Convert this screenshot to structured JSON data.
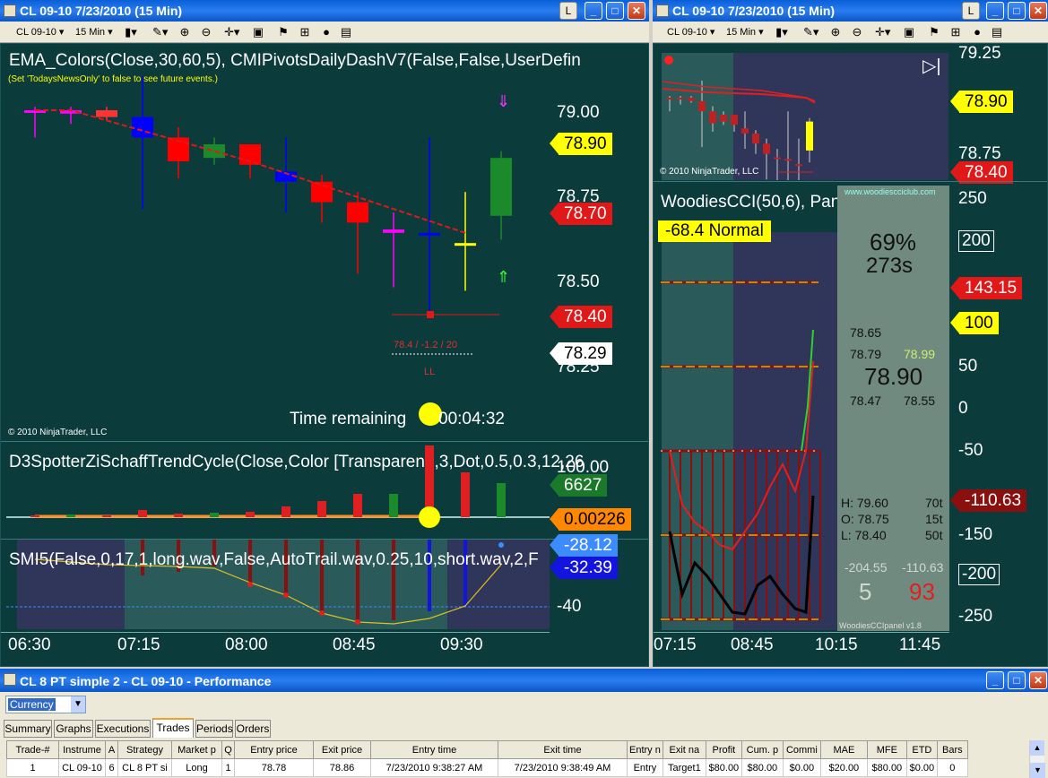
{
  "left_window": {
    "title": "CL 09-10  7/23/2010 (15 Min)",
    "l_button": "L",
    "instrument": "CL 09-10",
    "interval": "15 Min",
    "price_panel": {
      "indicator_label": "EMA_Colors(Close,30,60,5),   CMIPivotsDailyDashV7(False,False,UserDefin",
      "news_note": "(Set 'TodaysNewsOnly' to false to see future events.)",
      "copyright": "© 2010 NinjaTrader, LLC",
      "time_remaining_label": "Time remaining",
      "time_remaining_value": "00:04:32",
      "ll_label": "LL",
      "level_note": "78.4 / -1.2 / 20",
      "axis_labels": [
        "79.00",
        "78.75",
        "78.50",
        "78.25"
      ],
      "tags": [
        "78.90",
        "78.70",
        "78.40",
        "78.29"
      ],
      "candles": [
        {
          "o": 79.0,
          "h": 79.01,
          "l": 78.92,
          "c": 79.0,
          "color": "#ff00ff"
        },
        {
          "o": 78.99,
          "h": 79.01,
          "l": 78.96,
          "c": 79.0,
          "color": "#ff00ff"
        },
        {
          "o": 79.0,
          "h": 79.01,
          "l": 78.97,
          "c": 78.98,
          "color": "#ff3333"
        },
        {
          "o": 78.98,
          "h": 79.1,
          "l": 78.71,
          "c": 78.92,
          "color": "#0000ff"
        },
        {
          "o": 78.92,
          "h": 78.95,
          "l": 78.8,
          "c": 78.85,
          "color": "#ff0000"
        },
        {
          "o": 78.86,
          "h": 78.92,
          "l": 78.84,
          "c": 78.9,
          "color": "#1a8a2a"
        },
        {
          "o": 78.9,
          "h": 78.9,
          "l": 78.8,
          "c": 78.84,
          "color": "#ff0000"
        },
        {
          "o": 78.82,
          "h": 78.92,
          "l": 78.7,
          "c": 78.79,
          "color": "#0000ff"
        },
        {
          "o": 78.79,
          "h": 78.81,
          "l": 78.67,
          "c": 78.73,
          "color": "#ff0000"
        },
        {
          "o": 78.73,
          "h": 78.76,
          "l": 78.52,
          "c": 78.67,
          "color": "#ff0000"
        },
        {
          "o": 78.65,
          "h": 78.7,
          "l": 78.48,
          "c": 78.64,
          "color": "#ff00ff"
        },
        {
          "o": 78.64,
          "h": 78.92,
          "l": 78.4,
          "c": 78.64,
          "color": "#0000ff"
        },
        {
          "o": 78.61,
          "h": 78.76,
          "l": 78.47,
          "c": 78.61,
          "color": "#ffff00"
        },
        {
          "o": 78.69,
          "h": 78.88,
          "l": 78.62,
          "c": 78.86,
          "color": "#1a8a2a"
        }
      ]
    },
    "schaff_panel": {
      "label": "D3SpotterZiSchaffTrendCycle(Close,Color [Transparent],3,Dot,0.5,0.3,12,26",
      "axis_label": "100.00",
      "tags": [
        "6627",
        "0.00226"
      ]
    },
    "smi_panel": {
      "label": "SMI5(False,0,17,1,long.wav,False,AutoTrail.wav,0.25,10,short.wav,2,F",
      "axis_label": "-40",
      "tags": [
        "-28.12",
        "-32.39"
      ]
    },
    "time_labels": [
      "06:30",
      "07:15",
      "08:00",
      "08:45",
      "09:30"
    ]
  },
  "right_window": {
    "title": "CL 09-10  7/23/2010 (15 Min)",
    "l_button": "L",
    "instrument": "CL 09-10",
    "interval": "15 Min",
    "copyright": "© 2010 NinjaTrader, LLC",
    "price_axis": [
      "79.25",
      "78.75"
    ],
    "price_tags": [
      "78.90",
      "78.40"
    ],
    "cci_label": "WoodiesCCI(50,6), Panel(50)",
    "cci_status": "-68.4 Normal",
    "cci_brand": "www.woodiescciclub.com",
    "cci_axis": [
      "250",
      "200",
      "150",
      "100",
      "50",
      "0",
      "-50",
      "-100",
      "-150",
      "-200",
      "-250"
    ],
    "cci_tags": [
      "143.15",
      "100",
      "-110.63"
    ],
    "dash": {
      "pct": "69%",
      "secs": "273s",
      "p1": "78.65",
      "p2": "78.79",
      "p2b": "78.99",
      "big": "78.90",
      "p3": "78.47",
      "p3b": "78.55",
      "h_label": "H: 79.60",
      "h_ticks": "70t",
      "o_label": "O: 78.75",
      "o_ticks": "15t",
      "l_label": "L: 78.40",
      "l_ticks": "50t",
      "v1": "-204.55",
      "v2": "-110.63",
      "n1": "5",
      "n2": "93",
      "version": "WoodiesCCIpanel v1.8"
    },
    "time_labels": [
      "07:15",
      "08:45",
      "10:15",
      "11:45"
    ]
  },
  "perf_window": {
    "title": "CL 8 PT simple 2 - CL 09-10 - Performance",
    "display_select": "Currency",
    "tabs": [
      "Summary",
      "Graphs",
      "Executions",
      "Trades",
      "Periods",
      "Orders"
    ],
    "active_tab": "Trades",
    "columns": [
      "Trade-#",
      "Instrume",
      "A",
      "Strategy",
      "Market p",
      "Q",
      "Entry price",
      "Exit price",
      "Entry time",
      "Exit time",
      "Entry n",
      "Exit na",
      "Profit",
      "Cum. p",
      "Commi",
      "MAE",
      "MFE",
      "ETD",
      "Bars"
    ],
    "rows": [
      [
        "1",
        "CL 09-10",
        "6",
        "CL 8 PT si",
        "Long",
        "1",
        "78.78",
        "78.86",
        "7/23/2010 9:38:27 AM",
        "7/23/2010 9:38:49 AM",
        "Entry",
        "Target1",
        "$80.00",
        "$80.00",
        "$0.00",
        "$20.00",
        "$80.00",
        "$0.00",
        "0"
      ]
    ]
  },
  "colors": {
    "chart_bg": "#0c3b3b",
    "title_bar": "#0a5fd8"
  }
}
